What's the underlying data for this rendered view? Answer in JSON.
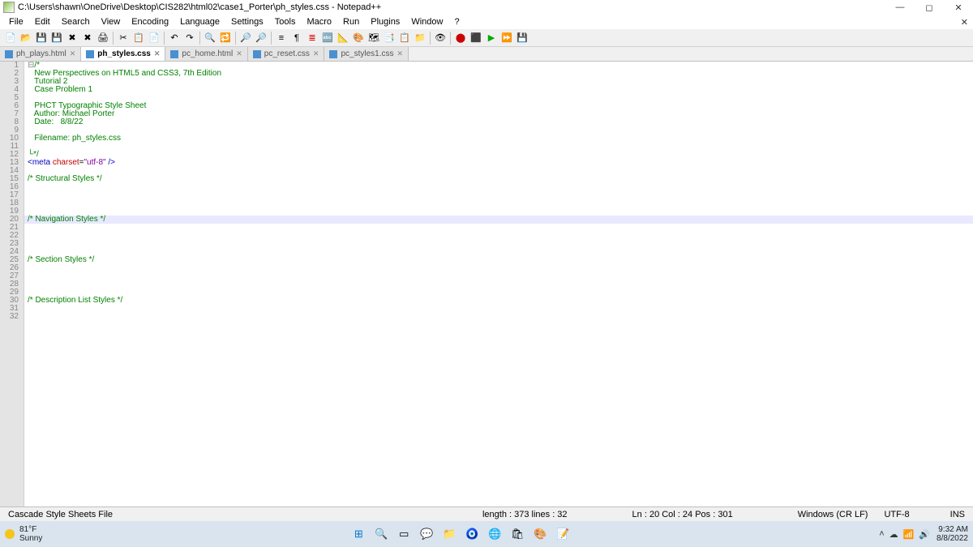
{
  "titlebar": {
    "path": "C:\\Users\\shawn\\OneDrive\\Desktop\\CIS282\\html02\\case1_Porter\\ph_styles.css - Notepad++"
  },
  "menu": {
    "items": [
      "File",
      "Edit",
      "Search",
      "View",
      "Encoding",
      "Language",
      "Settings",
      "Tools",
      "Macro",
      "Run",
      "Plugins",
      "Window",
      "?"
    ]
  },
  "tabs": [
    {
      "label": "ph_plays.html",
      "active": false
    },
    {
      "label": "ph_styles.css",
      "active": true
    },
    {
      "label": "pc_home.html",
      "active": false
    },
    {
      "label": "pc_reset.css",
      "active": false
    },
    {
      "label": "pc_styles1.css",
      "active": false
    }
  ],
  "gutter_max": 32,
  "code_lines": [
    {
      "n": 1,
      "segs": [
        {
          "t": "⊟",
          "c": "c-gray"
        },
        {
          "t": "/*",
          "c": "c-green"
        }
      ]
    },
    {
      "n": 2,
      "segs": [
        {
          "t": "   New Perspectives on HTML5 and CSS3, 7th Edition",
          "c": "c-green"
        }
      ]
    },
    {
      "n": 3,
      "segs": [
        {
          "t": "   Tutorial 2",
          "c": "c-green"
        }
      ]
    },
    {
      "n": 4,
      "segs": [
        {
          "t": "   Case Problem 1",
          "c": "c-green"
        }
      ]
    },
    {
      "n": 5,
      "segs": [
        {
          "t": "",
          "c": ""
        }
      ]
    },
    {
      "n": 6,
      "segs": [
        {
          "t": "   PHCT Typographic Style Sheet",
          "c": "c-green"
        }
      ]
    },
    {
      "n": 7,
      "segs": [
        {
          "t": "   Author: Michael Porter",
          "c": "c-green"
        }
      ]
    },
    {
      "n": 8,
      "segs": [
        {
          "t": "   Date:   8/8/22",
          "c": "c-green"
        }
      ]
    },
    {
      "n": 9,
      "segs": [
        {
          "t": "",
          "c": ""
        }
      ]
    },
    {
      "n": 10,
      "segs": [
        {
          "t": "   Filename: ph_styles.css",
          "c": "c-green"
        }
      ]
    },
    {
      "n": 11,
      "segs": [
        {
          "t": "",
          "c": ""
        }
      ]
    },
    {
      "n": 12,
      "segs": [
        {
          "t": "└*/",
          "c": "c-green"
        }
      ]
    },
    {
      "n": 13,
      "segs": [
        {
          "t": "<",
          "c": "c-blue"
        },
        {
          "t": "meta",
          "c": "c-blue"
        },
        {
          "t": " ",
          "c": ""
        },
        {
          "t": "charset",
          "c": "c-red"
        },
        {
          "t": "=",
          "c": ""
        },
        {
          "t": "\"utf-8\"",
          "c": "c-purple"
        },
        {
          "t": " />",
          "c": "c-blue"
        }
      ]
    },
    {
      "n": 14,
      "segs": [
        {
          "t": "",
          "c": ""
        }
      ]
    },
    {
      "n": 15,
      "segs": [
        {
          "t": "/* Structural Styles */",
          "c": "c-green"
        }
      ]
    },
    {
      "n": 16,
      "segs": [
        {
          "t": "",
          "c": ""
        }
      ]
    },
    {
      "n": 17,
      "segs": [
        {
          "t": "",
          "c": ""
        }
      ]
    },
    {
      "n": 18,
      "segs": [
        {
          "t": "",
          "c": ""
        }
      ]
    },
    {
      "n": 19,
      "segs": [
        {
          "t": "",
          "c": ""
        }
      ]
    },
    {
      "n": 20,
      "hl": true,
      "segs": [
        {
          "t": "/* Navigation Styles */",
          "c": "c-green"
        }
      ]
    },
    {
      "n": 21,
      "segs": [
        {
          "t": "",
          "c": ""
        }
      ]
    },
    {
      "n": 22,
      "segs": [
        {
          "t": "",
          "c": ""
        }
      ]
    },
    {
      "n": 23,
      "segs": [
        {
          "t": "",
          "c": ""
        }
      ]
    },
    {
      "n": 24,
      "segs": [
        {
          "t": "",
          "c": ""
        }
      ]
    },
    {
      "n": 25,
      "segs": [
        {
          "t": "/* Section Styles */",
          "c": "c-green"
        }
      ]
    },
    {
      "n": 26,
      "segs": [
        {
          "t": "",
          "c": ""
        }
      ]
    },
    {
      "n": 27,
      "segs": [
        {
          "t": "",
          "c": ""
        }
      ]
    },
    {
      "n": 28,
      "segs": [
        {
          "t": "",
          "c": ""
        }
      ]
    },
    {
      "n": 29,
      "segs": [
        {
          "t": "",
          "c": ""
        }
      ]
    },
    {
      "n": 30,
      "segs": [
        {
          "t": "/* Description List Styles */",
          "c": "c-green"
        }
      ]
    },
    {
      "n": 31,
      "segs": [
        {
          "t": "",
          "c": ""
        }
      ]
    },
    {
      "n": 32,
      "segs": [
        {
          "t": "",
          "c": ""
        }
      ]
    }
  ],
  "status": {
    "type": "Cascade Style Sheets File",
    "length": "length : 373    lines : 32",
    "pos": "Ln : 20    Col : 24    Pos : 301",
    "eol": "Windows (CR LF)",
    "enc": "UTF-8",
    "ins": "INS"
  },
  "taskbar": {
    "temp": "81°F",
    "cond": "Sunny",
    "time": "9:32 AM",
    "date": "8/8/2022"
  }
}
